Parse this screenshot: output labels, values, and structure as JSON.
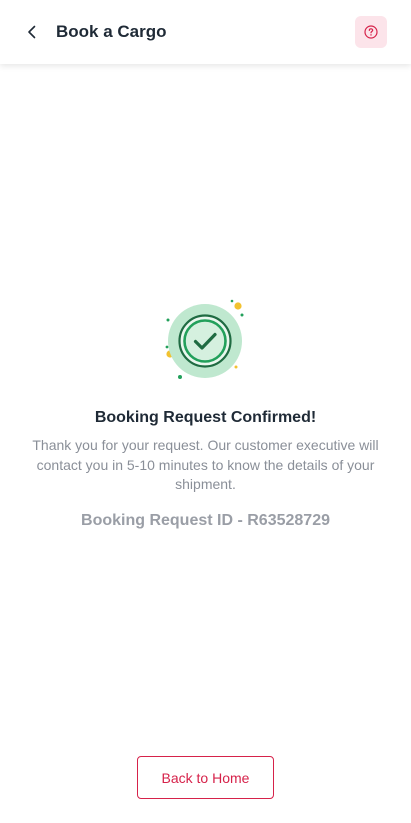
{
  "header": {
    "title": "Book a Cargo",
    "back_icon": "chevron-left-icon",
    "help_icon": "question-circle-icon"
  },
  "confirmation": {
    "icon": "check-circle-icon",
    "title": "Booking Request Confirmed!",
    "message": "Thank you for your request. Our customer executive will contact you in 5-10 minutes to know the details of your shipment.",
    "request_id": "Booking Request ID - R63528729"
  },
  "actions": {
    "back_home_label": "Back to Home"
  },
  "colors": {
    "brand": "#d6224a",
    "brand_light": "#fce4ea",
    "success": "#22a05b",
    "success_light": "#bfe8cf",
    "title_text": "#1f2a36",
    "muted_text": "#8a8f98"
  }
}
